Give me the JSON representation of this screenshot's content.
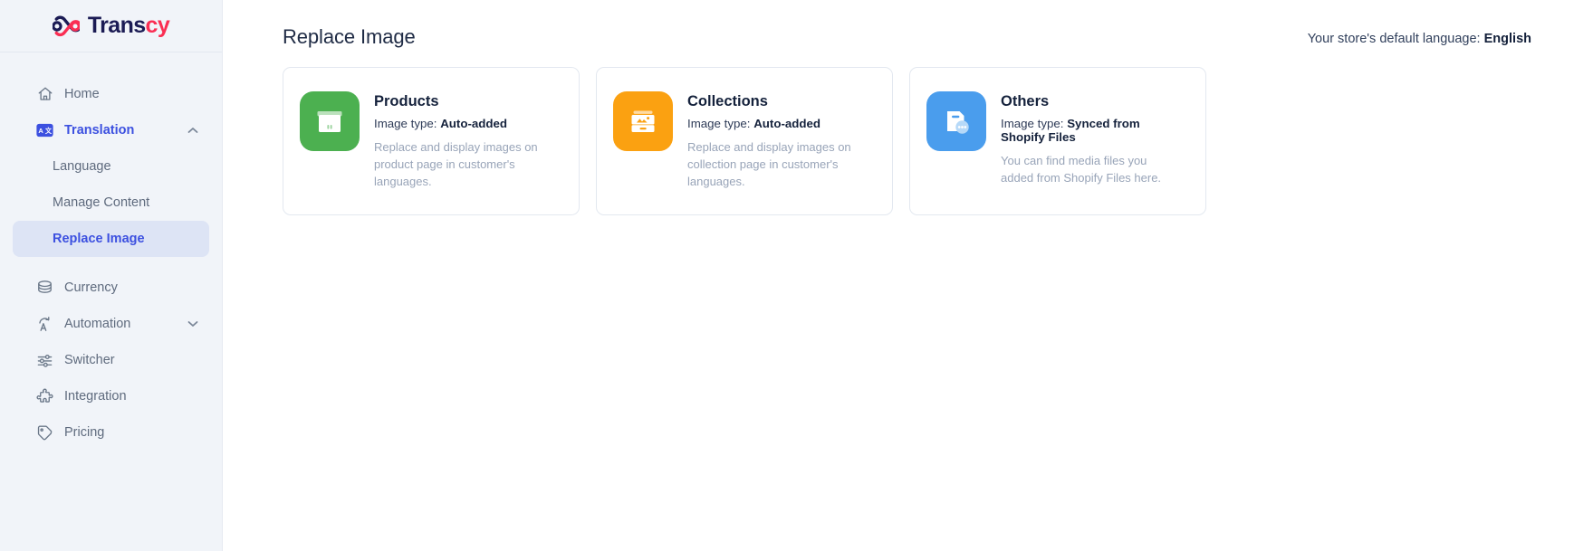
{
  "brand": {
    "name_part1": "Trans",
    "name_part2": "cy",
    "navy": "#1b1b54",
    "red": "#fa2e53"
  },
  "sidebar": {
    "items": [
      {
        "label": "Home",
        "icon": "home-icon",
        "type": "item"
      },
      {
        "label": "Translation",
        "icon": "translate-icon",
        "type": "item",
        "state": "active-parent",
        "chevron": "chevron-up"
      },
      {
        "label": "Language",
        "icon": "",
        "type": "sub"
      },
      {
        "label": "Manage Content",
        "icon": "",
        "type": "sub"
      },
      {
        "label": "Replace Image",
        "icon": "",
        "type": "sub",
        "state": "selected"
      },
      {
        "label": "Currency",
        "icon": "coins-icon",
        "type": "item"
      },
      {
        "label": "Automation",
        "icon": "auto-translate-icon",
        "type": "item",
        "chevron": "chevron-down"
      },
      {
        "label": "Switcher",
        "icon": "sliders-icon",
        "type": "item"
      },
      {
        "label": "Integration",
        "icon": "puzzle-icon",
        "type": "item"
      },
      {
        "label": "Pricing",
        "icon": "tag-icon",
        "type": "item"
      }
    ]
  },
  "header": {
    "title": "Replace Image",
    "language_label": "Your store's default language:",
    "language_value": "English"
  },
  "cards": [
    {
      "title": "Products",
      "type_label": "Image type:",
      "type_value": "Auto-added",
      "description": "Replace and display images on product page in customer's languages.",
      "icon": "product-box-icon",
      "color": "#4cb050"
    },
    {
      "title": "Collections",
      "type_label": "Image type:",
      "type_value": "Auto-added",
      "description": "Replace and display images on collection page in customer's languages.",
      "icon": "collection-gallery-icon",
      "color": "#fba111"
    },
    {
      "title": "Others",
      "type_label": "Image type:",
      "type_value": "Synced from Shopify Files",
      "description": "You can find media files you added from Shopify Files here.",
      "icon": "file-dots-icon",
      "color": "#4a9ded"
    }
  ]
}
